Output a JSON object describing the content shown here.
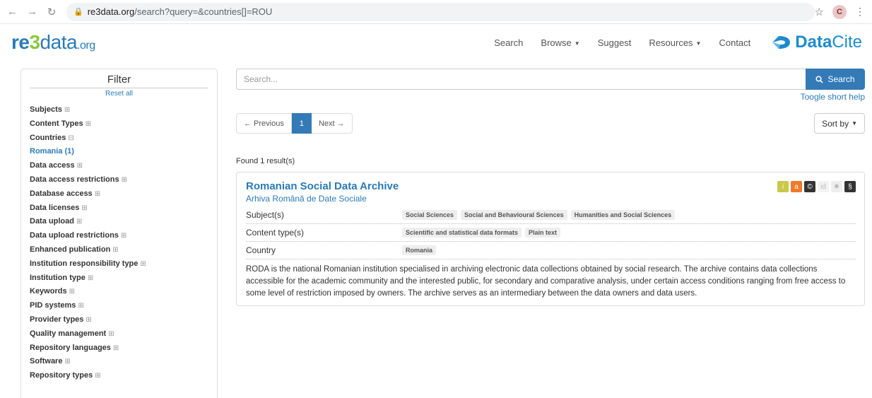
{
  "browser": {
    "url_host": "re3data.org",
    "url_path": "/search?query=&countries[]=ROU",
    "avatar": "C"
  },
  "site": {
    "logo": {
      "re": "re",
      "three": "3",
      "data": "data",
      "org": ".org"
    },
    "nav": [
      {
        "label": "Search"
      },
      {
        "label": "Browse"
      },
      {
        "label": "Suggest"
      },
      {
        "label": "Resources"
      },
      {
        "label": "Contact"
      }
    ],
    "partner": {
      "bold": "Data",
      "rest": "Cite"
    }
  },
  "filter": {
    "title": "Filter",
    "reset": "Reset all",
    "facets": [
      {
        "label": "Subjects",
        "toggle": "⊞"
      },
      {
        "label": "Content Types",
        "toggle": "⊞"
      },
      {
        "label": "Countries",
        "toggle": "⊟"
      },
      {
        "label": "Romania (1)",
        "toggle": ""
      },
      {
        "label": "Data access",
        "toggle": "⊞"
      },
      {
        "label": "Data access restrictions",
        "toggle": "⊞"
      },
      {
        "label": "Database access",
        "toggle": "⊞"
      },
      {
        "label": "Data licenses",
        "toggle": "⊞"
      },
      {
        "label": "Data upload",
        "toggle": "⊞"
      },
      {
        "label": "Data upload restrictions",
        "toggle": "⊞"
      },
      {
        "label": "Enhanced publication",
        "toggle": "⊞"
      },
      {
        "label": "Institution responsibility type",
        "toggle": "⊞"
      },
      {
        "label": "Institution type",
        "toggle": "⊞"
      },
      {
        "label": "Keywords",
        "toggle": "⊞"
      },
      {
        "label": "PID systems",
        "toggle": "⊞"
      },
      {
        "label": "Provider types",
        "toggle": "⊞"
      },
      {
        "label": "Quality management",
        "toggle": "⊞"
      },
      {
        "label": "Repository languages",
        "toggle": "⊞"
      },
      {
        "label": "Software",
        "toggle": "⊞"
      },
      {
        "label": "Repository types",
        "toggle": "⊞"
      }
    ]
  },
  "search": {
    "placeholder": "Search...",
    "button": "Search",
    "help": "Toogle short help"
  },
  "pagination": {
    "prev": "← Previous",
    "current": "1",
    "next": "Next →",
    "sort": "Sort by"
  },
  "results": {
    "count_text": "Found 1 result(s)",
    "items": [
      {
        "title": "Romanian Social Data Archive",
        "alt_title": "Arhiva Română de Date Sociale",
        "badges": [
          "i",
          "a",
          "©",
          "id",
          "✸",
          "§"
        ],
        "rows": [
          {
            "label": "Subject(s)",
            "tags": [
              "Social Sciences",
              "Social and Behavioural Sciences",
              "Humanities and Social Sciences"
            ]
          },
          {
            "label": "Content type(s)",
            "tags": [
              "Scientific and statistical data formats",
              "Plain text"
            ]
          },
          {
            "label": "Country",
            "tags": [
              "Romania"
            ]
          }
        ],
        "description": "RODA is the national Romanian institution specialised in archiving electronic data collections obtained by social research. The archive contains data collections accessible for the academic community and the interested public, for secondary and comparative analysis, under certain access conditions ranging from free access to some level of restriction imposed by owners. The archive serves as an intermediary between the data owners and data users."
      }
    ]
  }
}
